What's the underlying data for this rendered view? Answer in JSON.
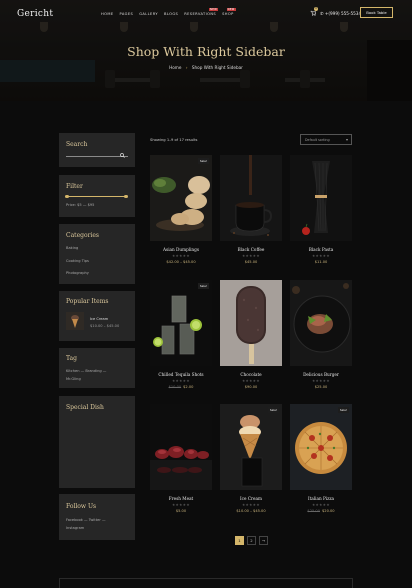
{
  "header": {
    "logo": "Gericht",
    "nav": [
      {
        "label": "HOME",
        "badge": ""
      },
      {
        "label": "PAGES",
        "badge": ""
      },
      {
        "label": "GALLERY",
        "badge": ""
      },
      {
        "label": "BLOGS",
        "badge": ""
      },
      {
        "label": "RESERVATIONS",
        "badge": "NEW"
      },
      {
        "label": "SHOP",
        "badge": "NEW"
      }
    ],
    "cart_count": "0",
    "phone": "+(999) 555-5534",
    "book_label": "Book Table"
  },
  "hero": {
    "title": "Shop With Right Sidebar",
    "breadcrumb_home": "Home",
    "breadcrumb_current": "Shop With Right Sidebar"
  },
  "sidebar": {
    "search_title": "Search",
    "filter_title": "Filter",
    "filter_price": "Price: $5 — $95",
    "categories_title": "Categories",
    "categories": [
      "Baking",
      "Cooking Tips",
      "Photography"
    ],
    "popular_title": "Popular Items",
    "popular_item_name": "Ice Cream",
    "popular_item_price": "$10.00 – $45.00",
    "tag_title": "Tag",
    "tags_line1": "Kitchen   —   Branding   —",
    "tags_line2": "Mr.Gling",
    "special_title": "Special Dish",
    "follow_title": "Follow Us",
    "follow_line1": "Facebook   —   Twitter   —",
    "follow_line2": "Instagram"
  },
  "shop": {
    "showing": "Showing 1–9 of 17 results",
    "sort": "Default sorting",
    "products": [
      {
        "name": "Asian Dumplings",
        "old": "",
        "price": "$42.00 – $45.00",
        "sale": "Sale!",
        "stars": "★★★★★"
      },
      {
        "name": "Black Coffee",
        "old": "",
        "price": "$45.00",
        "sale": "",
        "stars": "★★★★★"
      },
      {
        "name": "Black Pasta",
        "old": "",
        "price": "$11.00",
        "sale": "",
        "stars": "★★★★★"
      },
      {
        "name": "Chilled Tequila Shots",
        "old": "$10.00",
        "price": "$2.00",
        "sale": "Sale!",
        "stars": "★★★★★"
      },
      {
        "name": "Chocolate",
        "old": "",
        "price": "$90.00",
        "sale": "",
        "stars": "★★★★★"
      },
      {
        "name": "Delicious Burger",
        "old": "",
        "price": "$25.00",
        "sale": "",
        "stars": "★★★★★"
      },
      {
        "name": "Fresh Meat",
        "old": "",
        "price": "$5.00",
        "sale": "",
        "stars": "★★★★★"
      },
      {
        "name": "Ice Cream",
        "old": "",
        "price": "$10.00 – $45.00",
        "sale": "Sale!",
        "stars": "★★★★★"
      },
      {
        "name": "Italian Pizza",
        "old": "$25.00",
        "price": "$20.00",
        "sale": "Sale!",
        "stars": "★★★★★"
      }
    ],
    "pages": [
      "1",
      "2",
      "→"
    ]
  },
  "colors": {
    "accent": "#d4b66a",
    "background": "#0c0c0c",
    "widget": "#262626"
  }
}
